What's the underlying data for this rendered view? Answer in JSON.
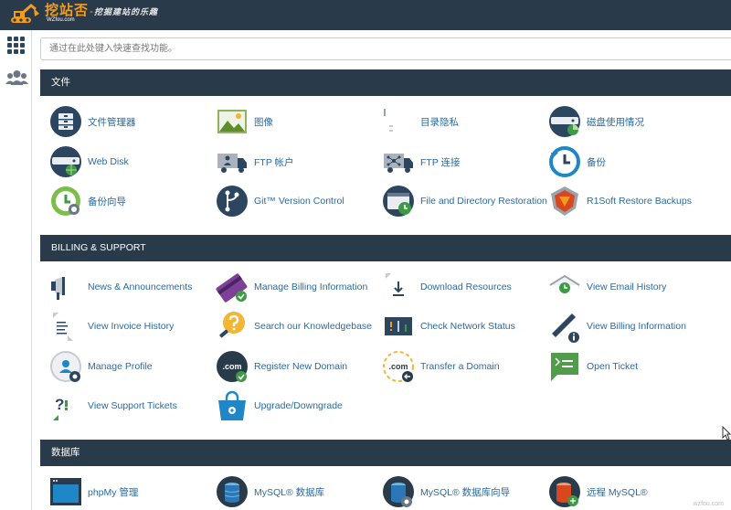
{
  "brand": {
    "name_cn": "挖站否",
    "slogan": "挖掘建站的乐趣",
    "domain": "WZfou.com"
  },
  "left_nav": {
    "items": [
      {
        "name": "apps-grid-icon"
      },
      {
        "name": "users-icon"
      }
    ]
  },
  "search": {
    "placeholder": "通过在此处键入快速查找功能。",
    "value": ""
  },
  "sections": [
    {
      "title": "文件",
      "items": [
        {
          "label": "文件管理器",
          "icon": "file-manager-icon"
        },
        {
          "label": "图像",
          "icon": "images-icon"
        },
        {
          "label": "目录隐私",
          "icon": "directory-privacy-icon"
        },
        {
          "label": "磁盘使用情况",
          "icon": "disk-usage-icon"
        },
        {
          "label": "Web Disk",
          "icon": "web-disk-icon"
        },
        {
          "label": "FTP 帐户",
          "icon": "ftp-accounts-icon"
        },
        {
          "label": "FTP 连接",
          "icon": "ftp-connections-icon"
        },
        {
          "label": "备份",
          "icon": "backup-icon"
        },
        {
          "label": "备份向导",
          "icon": "backup-wizard-icon"
        },
        {
          "label": "Git™ Version Control",
          "icon": "git-icon"
        },
        {
          "label": "File and Directory Restoration",
          "icon": "file-restore-icon"
        },
        {
          "label": "R1Soft Restore Backups",
          "icon": "r1soft-icon"
        }
      ]
    },
    {
      "title": "BILLING & SUPPORT",
      "items": [
        {
          "label": "News & Announcements",
          "icon": "megaphone-icon"
        },
        {
          "label": "Manage Billing Information",
          "icon": "credit-card-icon"
        },
        {
          "label": "Download Resources",
          "icon": "download-icon"
        },
        {
          "label": "View Email History",
          "icon": "email-history-icon"
        },
        {
          "label": "View Invoice History",
          "icon": "invoice-icon"
        },
        {
          "label": "Search our Knowledgebase",
          "icon": "knowledgebase-icon"
        },
        {
          "label": "Check Network Status",
          "icon": "network-status-icon"
        },
        {
          "label": "View Billing Information",
          "icon": "billing-info-icon"
        },
        {
          "label": "Manage Profile",
          "icon": "profile-icon"
        },
        {
          "label": "Register New Domain",
          "icon": "register-domain-icon"
        },
        {
          "label": "Transfer a Domain",
          "icon": "transfer-domain-icon"
        },
        {
          "label": "Open Ticket",
          "icon": "ticket-icon"
        },
        {
          "label": "View Support Tickets",
          "icon": "support-tickets-icon"
        },
        {
          "label": "Upgrade/Downgrade",
          "icon": "upgrade-icon"
        }
      ]
    },
    {
      "title": "数据库",
      "items": [
        {
          "label": "phpMy 管理",
          "icon": "phpmyadmin-icon"
        },
        {
          "label": "MySQL® 数据库",
          "icon": "mysql-icon"
        },
        {
          "label": "MySQL® 数据库向导",
          "icon": "mysql-wizard-icon"
        },
        {
          "label": "远程 MySQL®",
          "icon": "remote-mysql-icon"
        }
      ]
    }
  ],
  "watermark": "wzfou.com",
  "colors": {
    "header_bg": "#293a4a",
    "link": "#2b6aa0",
    "accent_orange": "#f29b1d",
    "icon_dark": "#2d4660",
    "icon_green": "#3d9b46",
    "icon_blue": "#1f86c8"
  }
}
